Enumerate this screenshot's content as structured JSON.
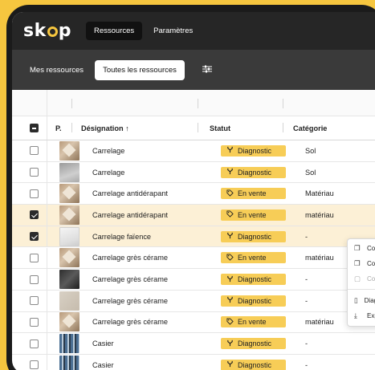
{
  "app": {
    "logo": "skop"
  },
  "topnav": {
    "tabs": [
      {
        "label": "Ressources"
      },
      {
        "label": "Paramètres"
      }
    ]
  },
  "filters": {
    "tabs": [
      {
        "label": "Mes ressources"
      },
      {
        "label": "Toutes les ressources"
      }
    ],
    "icon": "sliders-icon"
  },
  "table": {
    "headers": {
      "photo": "P.",
      "designation": "Désignation ↑",
      "statut": "Statut",
      "categorie": "Catégorie"
    },
    "rows": [
      {
        "designation": "Carrelage",
        "statut": "Diagnostic",
        "statut_icon": "fork-icon",
        "categorie": "Sol",
        "checked": false,
        "thumb": "tile"
      },
      {
        "designation": "Carrelage",
        "statut": "Diagnostic",
        "statut_icon": "fork-icon",
        "categorie": "Sol",
        "checked": false,
        "thumb": "grey"
      },
      {
        "designation": "Carrelage antidérapant",
        "statut": "En vente",
        "statut_icon": "tag-icon",
        "categorie": "Matériau",
        "checked": false,
        "thumb": "tile"
      },
      {
        "designation": "Carrelage antidérapant",
        "statut": "En vente",
        "statut_icon": "tag-icon",
        "categorie": "matériau",
        "checked": true,
        "thumb": "tile"
      },
      {
        "designation": "Carrelage faïence",
        "statut": "Diagnostic",
        "statut_icon": "fork-icon",
        "categorie": "-",
        "checked": true,
        "thumb": "white"
      },
      {
        "designation": "Carrelage grès cérame",
        "statut": "En vente",
        "statut_icon": "tag-icon",
        "categorie": "matériau",
        "checked": false,
        "thumb": "tile"
      },
      {
        "designation": "Carrelage grès cérame",
        "statut": "Diagnostic",
        "statut_icon": "fork-icon",
        "categorie": "-",
        "checked": false,
        "thumb": "dark"
      },
      {
        "designation": "Carrelage grès cérame",
        "statut": "Diagnostic",
        "statut_icon": "fork-icon",
        "categorie": "-",
        "checked": false,
        "thumb": "beige"
      },
      {
        "designation": "Carrelage grès cérame",
        "statut": "En vente",
        "statut_icon": "tag-icon",
        "categorie": "matériau",
        "checked": false,
        "thumb": "tile"
      },
      {
        "designation": "Casier",
        "statut": "Diagnostic",
        "statut_icon": "fork-icon",
        "categorie": "-",
        "checked": false,
        "thumb": "shelf"
      },
      {
        "designation": "Casier",
        "statut": "Diagnostic",
        "statut_icon": "fork-icon",
        "categorie": "-",
        "checked": false,
        "thumb": "shelf"
      }
    ]
  },
  "context_menu": {
    "items": [
      {
        "label": "Copier",
        "icon": "copy-icon",
        "disabled": false
      },
      {
        "label": "Copier",
        "icon": "copy-icon",
        "disabled": false
      },
      {
        "label": "Coller",
        "icon": "paste-icon",
        "disabled": true
      },
      {
        "label": "Diagnostic",
        "icon": "document-icon",
        "disabled": false
      },
      {
        "label": "Exporter",
        "icon": "export-icon",
        "disabled": false
      }
    ]
  },
  "colors": {
    "accent": "#f6c63f",
    "status_badge": "#f7cd57",
    "selected_row": "#fcf0d6",
    "topbar": "#262626",
    "filterbar": "#3a3a3a"
  }
}
